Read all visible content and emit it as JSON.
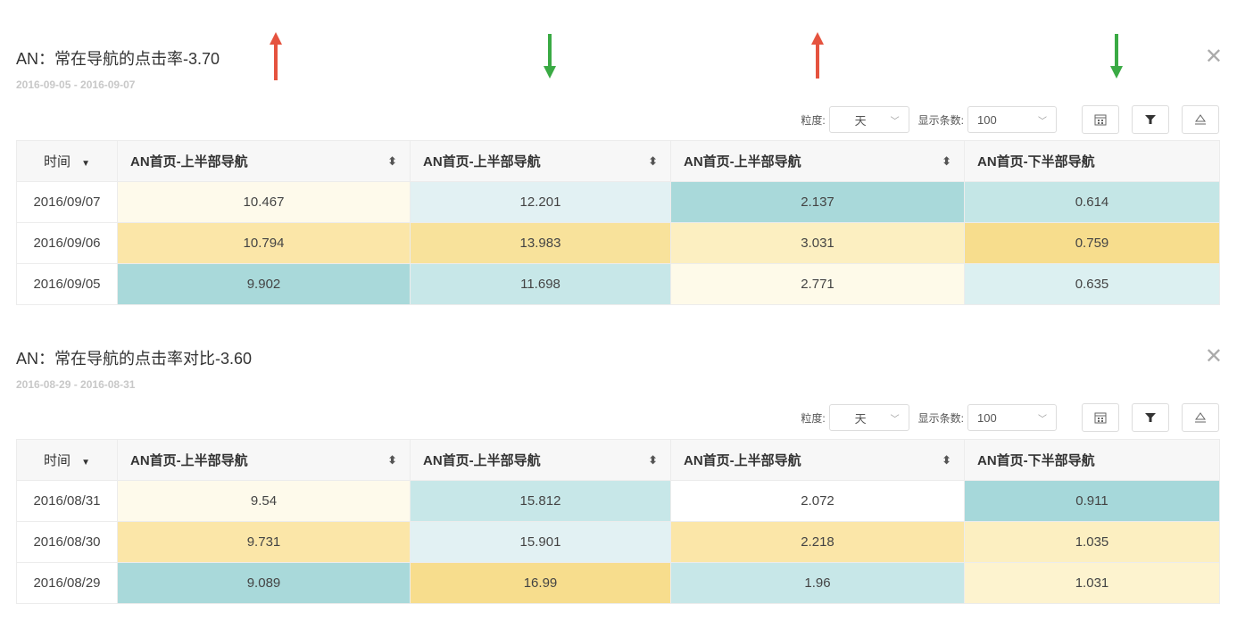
{
  "panels": [
    {
      "title": "AN：常在导航的点击率-3.70",
      "date_range": "2016-09-05 - 2016-09-07",
      "toolbar": {
        "granularity_label": "粒度:",
        "granularity_value": "天",
        "count_label": "显示条数:",
        "count_value": "100"
      },
      "headers": [
        "时间",
        "AN首页-上半部导航",
        "AN首页-上半部导航",
        "AN首页-上半部导航",
        "AN首页-下半部导航"
      ],
      "rows": [
        {
          "date": "2016/09/07",
          "cells": [
            "10.467",
            "12.201",
            "2.137",
            "0.614"
          ],
          "colors": [
            "#fefaeb",
            "#e2f1f3",
            "#a9d9da",
            "#c4e6e6"
          ]
        },
        {
          "date": "2016/09/06",
          "cells": [
            "10.794",
            "13.983",
            "3.031",
            "0.759"
          ],
          "colors": [
            "#fbe6a8",
            "#f8e29b",
            "#fcefc1",
            "#f7dd8d"
          ]
        },
        {
          "date": "2016/09/05",
          "cells": [
            "9.902",
            "11.698",
            "2.771",
            "0.635"
          ],
          "colors": [
            "#a9d9da",
            "#c7e7e8",
            "#fefae9",
            "#dcf0f1"
          ]
        }
      ]
    },
    {
      "title": "AN：常在导航的点击率对比-3.60",
      "date_range": "2016-08-29 - 2016-08-31",
      "toolbar": {
        "granularity_label": "粒度:",
        "granularity_value": "天",
        "count_label": "显示条数:",
        "count_value": "100"
      },
      "headers": [
        "时间",
        "AN首页-上半部导航",
        "AN首页-上半部导航",
        "AN首页-上半部导航",
        "AN首页-下半部导航"
      ],
      "rows": [
        {
          "date": "2016/08/31",
          "cells": [
            "9.54",
            "15.812",
            "2.072",
            "0.911"
          ],
          "colors": [
            "#fefaeb",
            "#c7e7e8",
            "#ffffff",
            "#a6d8da"
          ]
        },
        {
          "date": "2016/08/30",
          "cells": [
            "9.731",
            "15.901",
            "2.218",
            "1.035"
          ],
          "colors": [
            "#fbe6a8",
            "#e2f1f3",
            "#fbe6a8",
            "#fcefc1"
          ]
        },
        {
          "date": "2016/08/29",
          "cells": [
            "9.089",
            "16.99",
            "1.96",
            "1.031"
          ],
          "colors": [
            "#a9d9da",
            "#f7dd8d",
            "#c7e7e8",
            "#fdf3cf"
          ]
        }
      ]
    }
  ],
  "trend_arrows": [
    {
      "direction": "up",
      "color": "#e5533f"
    },
    {
      "direction": "down",
      "color": "#3aaa44"
    },
    {
      "direction": "up",
      "color": "#e5533f"
    },
    {
      "direction": "down",
      "color": "#3aaa44"
    }
  ],
  "icons": {
    "close": "close-icon",
    "sort_desc": "caret-down-icon",
    "sort": "sort-icon",
    "calendar": "calendar-icon",
    "filter": "filter-icon",
    "export": "export-icon"
  }
}
